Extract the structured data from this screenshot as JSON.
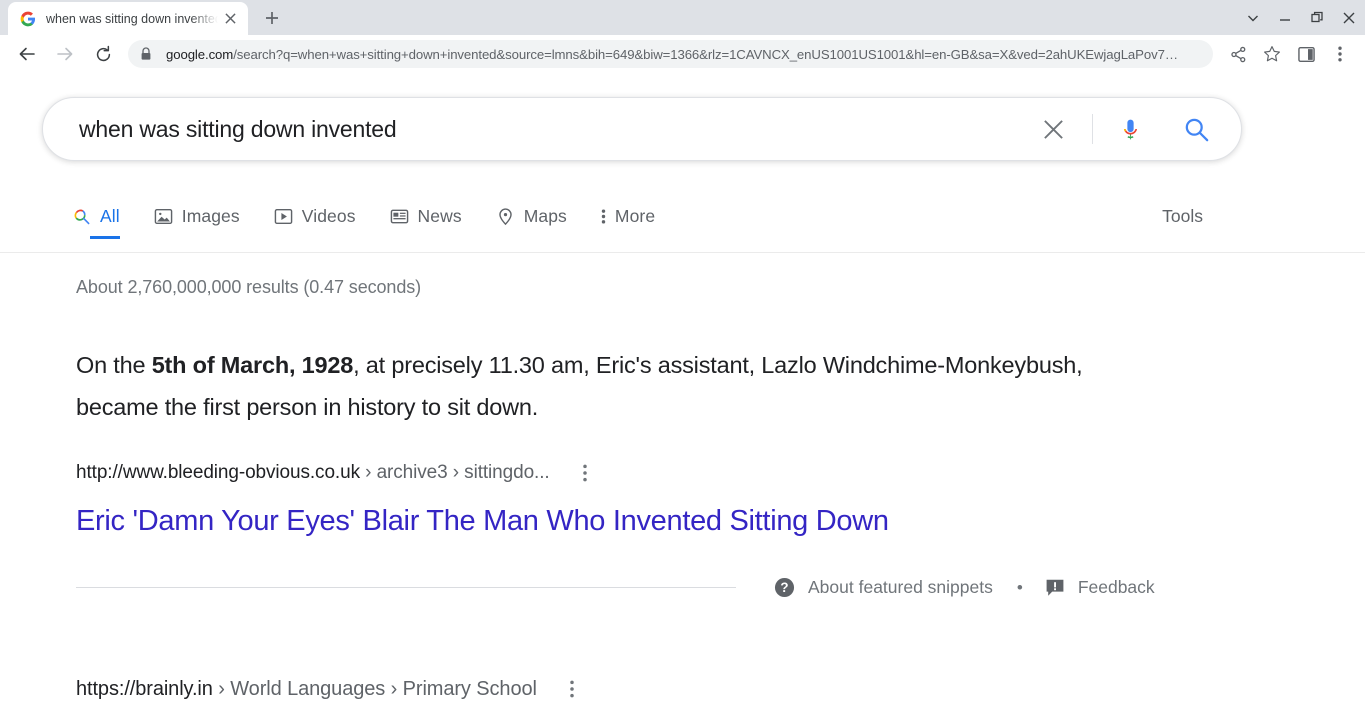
{
  "browser": {
    "tab": {
      "title": "when was sitting down invented",
      "favicon": "google-g-icon",
      "close_label": "✕"
    },
    "new_tab_label": "+",
    "window_controls": [
      "chevron-down-icon",
      "minimize-icon",
      "maximize-icon",
      "close-icon"
    ],
    "nav": {
      "back": "back-arrow-icon",
      "forward": "forward-arrow-icon",
      "reload": "reload-icon"
    },
    "omnibox": {
      "lock": "lock-icon",
      "host": "google.com",
      "path": "/search?q=when+was+sitting+down+invented&source=lmns&bih=649&biw=1366&rlz=1CAVNCX_enUS1001US1001&hl=en-GB&sa=X&ved=2ahUKEwjagLaPov7…"
    },
    "toolbar_icons": [
      "share-icon",
      "bookmark-star-icon",
      "side-panel-icon",
      "chrome-menu-icon"
    ]
  },
  "search": {
    "query": "when was sitting down invented",
    "placeholder": "Search Google or type a URL",
    "clear_label": "✕",
    "mic_icon": "google-mic-icon",
    "search_icon": "search-icon"
  },
  "navtabs": {
    "items": [
      {
        "label": "All",
        "icon": "google-search-icon",
        "active": true
      },
      {
        "label": "Images",
        "icon": "image-icon",
        "active": false
      },
      {
        "label": "Videos",
        "icon": "video-icon",
        "active": false
      },
      {
        "label": "News",
        "icon": "news-icon",
        "active": false
      },
      {
        "label": "Maps",
        "icon": "map-pin-icon",
        "active": false
      },
      {
        "label": "More",
        "icon": "more-vertical-icon",
        "active": false
      }
    ],
    "tools_label": "Tools"
  },
  "results": {
    "stats": "About 2,760,000,000 results (0.47 seconds)",
    "featured_snippet": {
      "text_before": "On the ",
      "text_bold": "5th of March, 1928",
      "text_after": ", at precisely 11.30 am, Eric's assistant, Lazlo Windchime-Monkeybush, became the first person in history to sit down.",
      "breadcrumb_url": "http://www.bleeding-obvious.co.uk",
      "breadcrumb_path": " › archive3 › sittingdo...",
      "title": "Eric 'Damn Your Eyes' Blair The Man Who Invented Sitting Down",
      "kebab_label": "⋮",
      "about_label": "About featured snippets",
      "about_icon": "help-circle-icon",
      "separator": "•",
      "feedback_label": "Feedback",
      "feedback_icon": "feedback-icon"
    },
    "next_result": {
      "breadcrumb_url": "https://brainly.in",
      "breadcrumb_path": " › World Languages › Primary School",
      "kebab_label": "⋮"
    }
  },
  "colors": {
    "google_blue": "#1a73e8",
    "link_purple": "#3425c4",
    "text_primary": "#202124",
    "text_secondary": "#70757a"
  }
}
